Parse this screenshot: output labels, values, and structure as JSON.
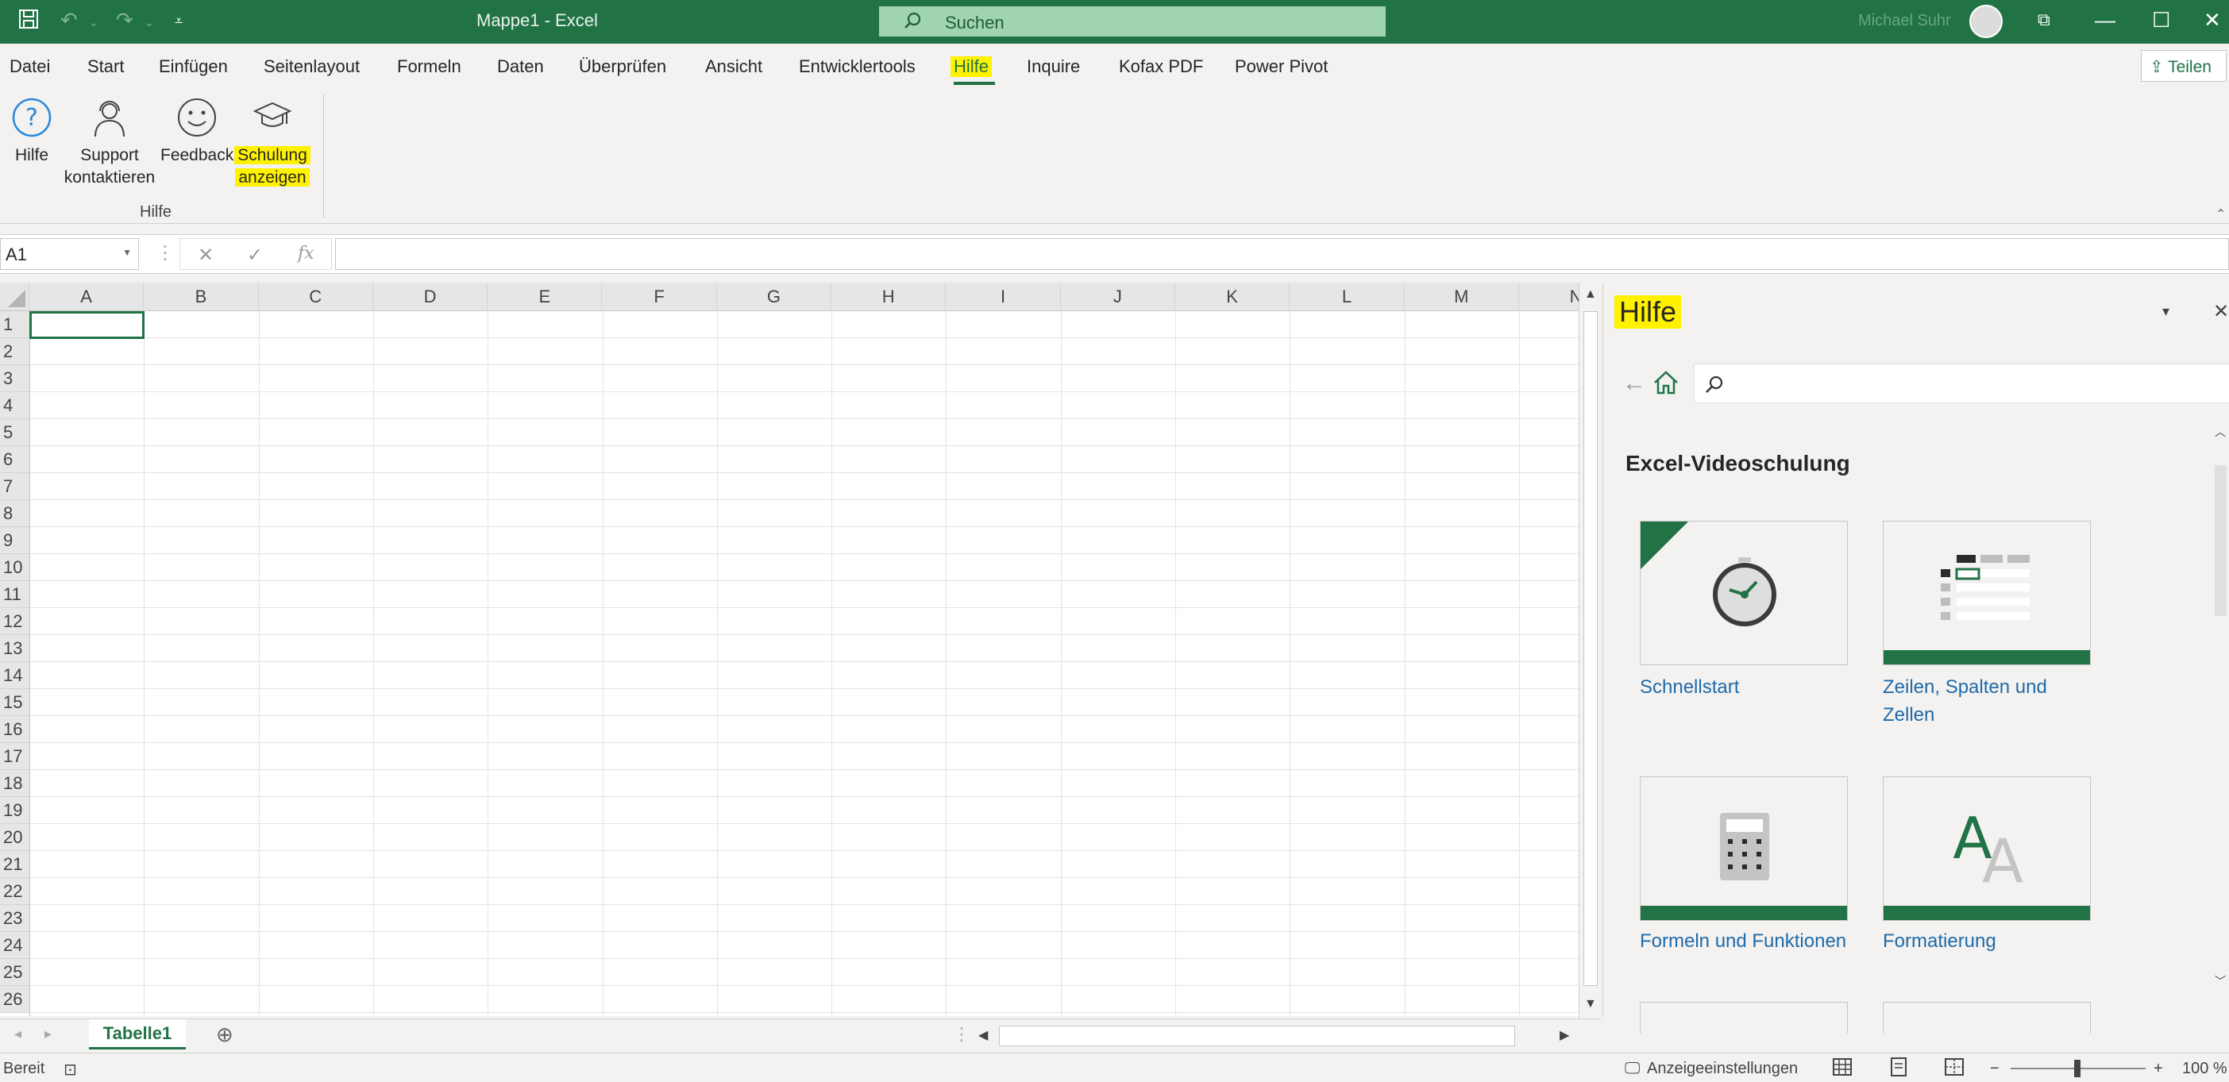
{
  "titlebar": {
    "document_title": "Mappe1  -  Excel",
    "search_placeholder": "Suchen",
    "user_name": "Michael Suhr"
  },
  "ribbon_tabs": [
    {
      "label": "Datei"
    },
    {
      "label": "Start"
    },
    {
      "label": "Einfügen"
    },
    {
      "label": "Seitenlayout"
    },
    {
      "label": "Formeln"
    },
    {
      "label": "Daten"
    },
    {
      "label": "Überprüfen"
    },
    {
      "label": "Ansicht"
    },
    {
      "label": "Entwicklertools"
    },
    {
      "label": "Hilfe"
    },
    {
      "label": "Inquire"
    },
    {
      "label": "Kofax PDF"
    },
    {
      "label": "Power Pivot"
    }
  ],
  "share_label": "Teilen",
  "ribbon": {
    "buttons": [
      {
        "line1": "Hilfe",
        "line2": ""
      },
      {
        "line1": "Support",
        "line2": "kontaktieren"
      },
      {
        "line1": "Feedback",
        "line2": ""
      },
      {
        "line1": "Schulung",
        "line2": "anzeigen"
      }
    ],
    "group_label": "Hilfe"
  },
  "formulabar": {
    "name_box": "A1",
    "fx_label": "fx",
    "formula": ""
  },
  "grid": {
    "columns": [
      "A",
      "B",
      "C",
      "D",
      "E",
      "F",
      "G",
      "H",
      "I",
      "J",
      "K",
      "L",
      "M",
      "N"
    ],
    "rows": [
      "1",
      "2",
      "3",
      "4",
      "5",
      "6",
      "7",
      "8",
      "9",
      "10",
      "11",
      "12",
      "13",
      "14",
      "15",
      "16",
      "17",
      "18",
      "19",
      "20",
      "21",
      "22",
      "23",
      "24",
      "25",
      "26"
    ]
  },
  "sheet_tab": "Tabelle1",
  "help_pane": {
    "title": "Hilfe",
    "search_placeholder": "",
    "heading": "Excel-Videoschulung",
    "tiles": [
      {
        "label": "Schnellstart"
      },
      {
        "label": "Zeilen, Spalten und Zellen"
      },
      {
        "label": "Formeln und Funktionen"
      },
      {
        "label": "Formatierung"
      }
    ]
  },
  "statusbar": {
    "status": "Bereit",
    "display_settings": "Anzeigeeinstellungen",
    "zoom": "100 %"
  },
  "colors": {
    "excel_green": "#217346",
    "highlight_yellow": "#fff200",
    "link_blue": "#1f6aa8"
  }
}
